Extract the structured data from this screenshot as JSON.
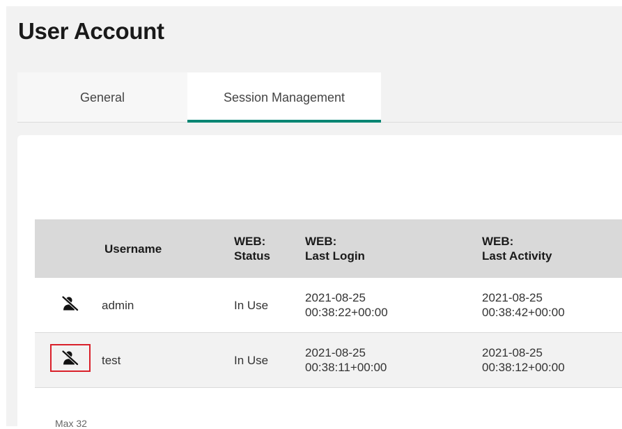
{
  "header": {
    "title": "User Account"
  },
  "tabs": [
    {
      "label": "General",
      "active": false
    },
    {
      "label": "Session Management",
      "active": true
    }
  ],
  "colors": {
    "accent": "#008573",
    "highlight_box": "#d9202a"
  },
  "table": {
    "columns": {
      "username": "Username",
      "web_status_line1": "WEB:",
      "web_status_line2": "Status",
      "last_login_line1": "WEB:",
      "last_login_line2": "Last Login",
      "last_activity_line1": "WEB:",
      "last_activity_line2": "Last Activity"
    },
    "rows": [
      {
        "icon": "user-slash-icon",
        "username": "admin",
        "status": "In Use",
        "last_login_date": "2021-08-25",
        "last_login_time": "00:38:22+00:00",
        "last_activity_date": "2021-08-25",
        "last_activity_time": "00:38:42+00:00"
      },
      {
        "icon": "user-slash-icon",
        "username": "test",
        "status": "In Use",
        "last_login_date": "2021-08-25",
        "last_login_time": "00:38:11+00:00",
        "last_activity_date": "2021-08-25",
        "last_activity_time": "00:38:12+00:00"
      }
    ]
  },
  "footer": {
    "max_note": "Max 32"
  }
}
